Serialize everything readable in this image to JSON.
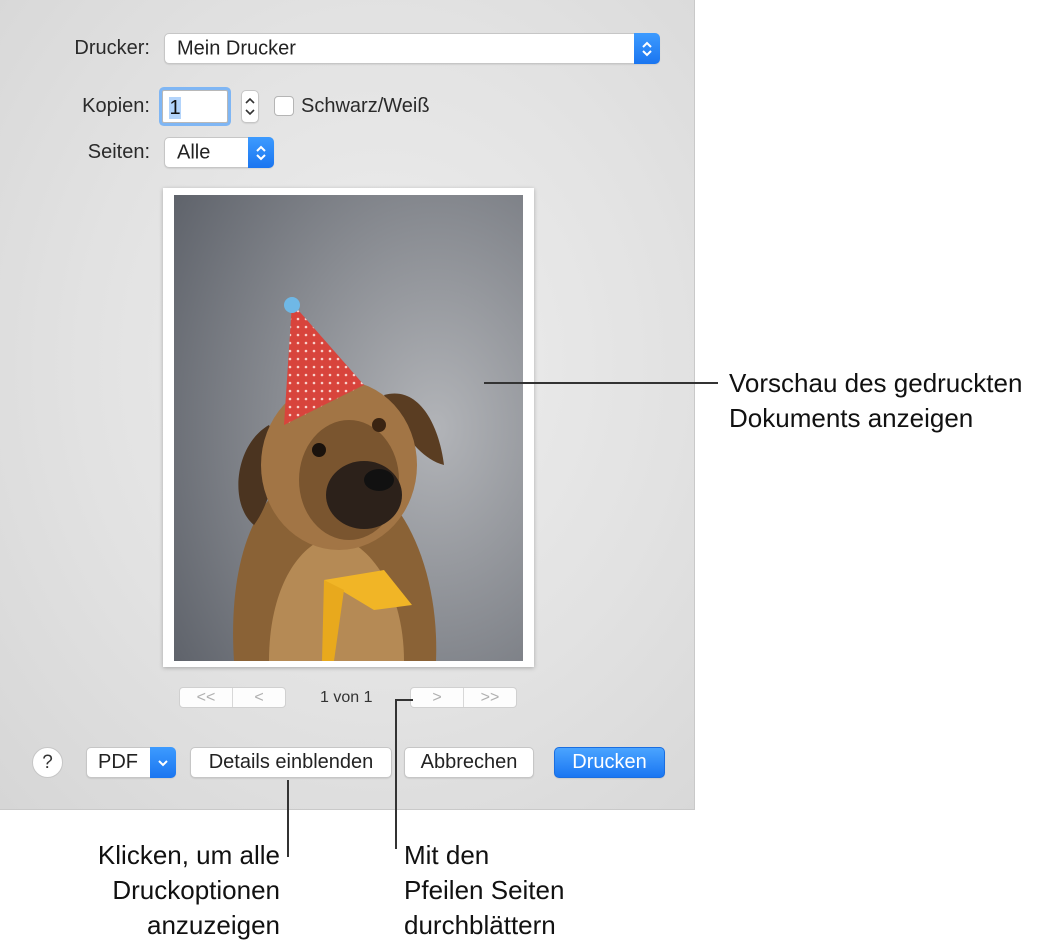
{
  "printer": {
    "label": "Drucker:",
    "value": "Mein Drucker"
  },
  "copies": {
    "label": "Kopien:",
    "value": "1",
    "bw_label": "Schwarz/Weiß",
    "bw_checked": false
  },
  "pages": {
    "label": "Seiten:",
    "value": "Alle"
  },
  "preview": {
    "page_indicator": "1 von 1"
  },
  "pager": {
    "first": "<<",
    "prev": "<",
    "next": ">",
    "last": ">>"
  },
  "toolbar": {
    "help": "?",
    "pdf": "PDF",
    "details": "Details einblenden",
    "cancel": "Abbrechen",
    "print": "Drucken"
  },
  "callouts": {
    "preview": [
      "Vorschau des gedruckten",
      "Dokuments anzeigen"
    ],
    "details": [
      "Klicken, um alle",
      "Druckoptionen",
      "anzuzeigen"
    ],
    "pager": [
      "Mit den",
      "Pfeilen Seiten",
      "durchblättern"
    ]
  },
  "colors": {
    "accent": "#1a76f2",
    "focus_ring": "#7fb6f4"
  }
}
